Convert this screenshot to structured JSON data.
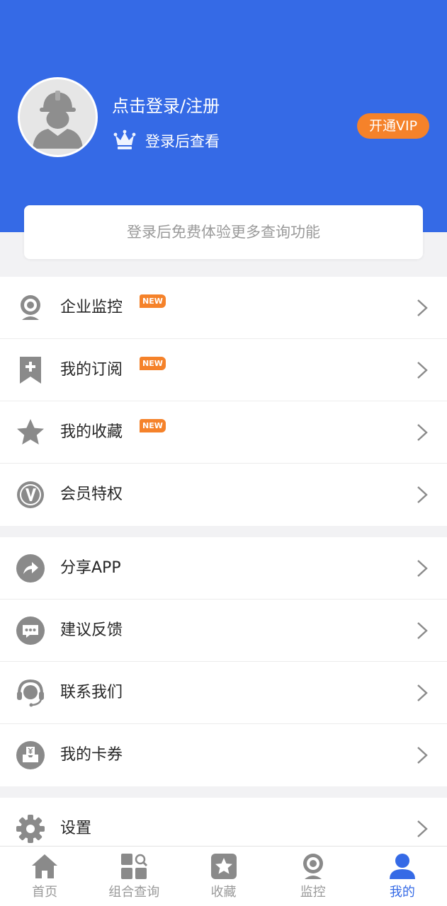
{
  "header": {
    "login_title": "点击登录/注册",
    "login_subtitle": "登录后查看",
    "vip_button": "开通VIP",
    "background_color": "#356ae6"
  },
  "promo": {
    "text": "登录后免费体验更多查询功能"
  },
  "menu_groups": [
    [
      {
        "label": "企业监控",
        "badge": "NEW",
        "icon": "webcam-icon"
      },
      {
        "label": "我的订阅",
        "badge": "NEW",
        "icon": "bookmark-plus-icon"
      },
      {
        "label": "我的收藏",
        "badge": "NEW",
        "icon": "star-icon"
      },
      {
        "label": "会员特权",
        "badge": "",
        "icon": "vip-circle-icon"
      }
    ],
    [
      {
        "label": "分享APP",
        "badge": "",
        "icon": "share-icon"
      },
      {
        "label": "建议反馈",
        "badge": "",
        "icon": "chat-bubble-icon"
      },
      {
        "label": "联系我们",
        "badge": "",
        "icon": "headset-icon"
      },
      {
        "label": "我的卡券",
        "badge": "",
        "icon": "coupon-box-icon"
      }
    ],
    [
      {
        "label": "设置",
        "badge": "",
        "icon": "gear-icon"
      }
    ]
  ],
  "tabbar": [
    {
      "label": "首页",
      "icon": "home-icon",
      "active": false
    },
    {
      "label": "组合查询",
      "icon": "grid-search-icon",
      "active": false
    },
    {
      "label": "收藏",
      "icon": "star-box-icon",
      "active": false
    },
    {
      "label": "监控",
      "icon": "webcam-icon",
      "active": false
    },
    {
      "label": "我的",
      "icon": "user-icon",
      "active": true
    }
  ],
  "colors": {
    "accent": "#356ae6",
    "badge": "#f5822a",
    "icon_gray": "#8a8a8a"
  }
}
